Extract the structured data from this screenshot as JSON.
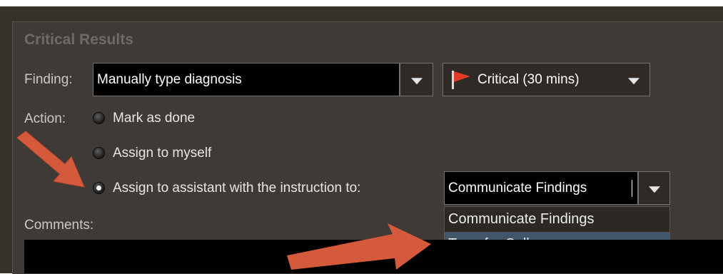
{
  "section": {
    "title": "Critical Results"
  },
  "finding": {
    "label": "Finding:",
    "value": "Manually type diagnosis"
  },
  "priority": {
    "value": "Critical (30 mins)",
    "flag_color": "#e23b2a"
  },
  "action": {
    "label": "Action:",
    "options": [
      "Mark as done",
      "Assign to myself",
      "Assign to assistant with the instruction to:"
    ],
    "selected_index": 2
  },
  "instruction": {
    "value": "Communicate Findings",
    "options": [
      "Communicate Findings",
      "Transfer Call"
    ],
    "highlighted_index": 1
  },
  "comments": {
    "label": "Comments:"
  },
  "annotation": {
    "arrow_color": "#d55a3c"
  }
}
